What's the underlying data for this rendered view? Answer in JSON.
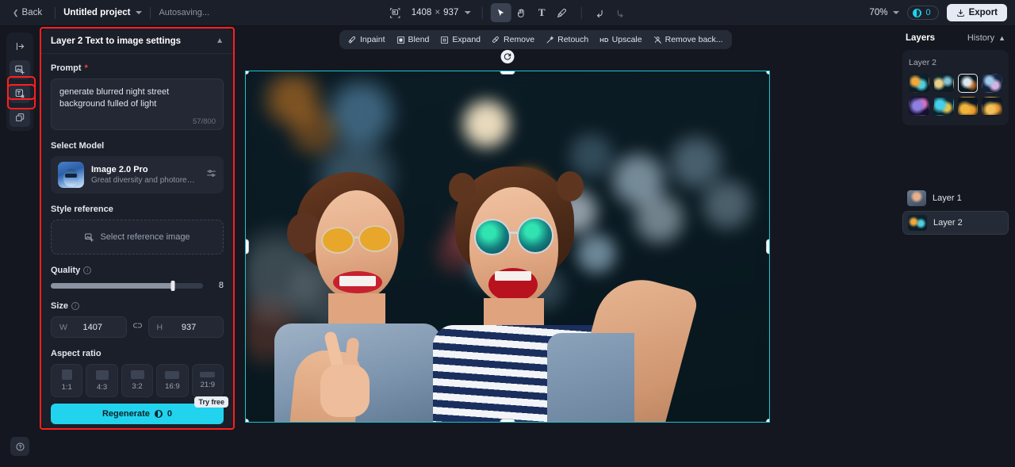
{
  "topbar": {
    "back_label": "Back",
    "project_name": "Untitled project",
    "autosave_status": "Autosaving...",
    "dimensions_w": "1408",
    "dimensions_x": "×",
    "dimensions_h": "937",
    "zoom_level": "70%",
    "credits_count": "0",
    "export_label": "Export",
    "tools": [
      {
        "name": "select-tool",
        "glyph": "cursor"
      },
      {
        "name": "hand-tool",
        "glyph": "hand"
      },
      {
        "name": "text-tool",
        "glyph": "T"
      },
      {
        "name": "brush-tool",
        "glyph": "brush"
      },
      {
        "name": "undo-tool",
        "glyph": "undo"
      },
      {
        "name": "redo-tool",
        "glyph": "redo"
      }
    ]
  },
  "panel": {
    "title": "Layer 2 Text to image settings",
    "prompt_label": "Prompt",
    "prompt_required_mark": "*",
    "prompt_value": "generate blurred night street background fulled of light",
    "prompt_char_count": "57/800",
    "model_label": "Select Model",
    "model_name": "Image 2.0 Pro",
    "model_desc": "Great diversity and photorealism. Of...",
    "style_label": "Style reference",
    "style_placeholder": "Select reference image",
    "quality_label": "Quality",
    "quality_value": "8",
    "quality_percent": 80,
    "size_label": "Size",
    "size_w_key": "W",
    "size_w_value": "1407",
    "size_h_key": "H",
    "size_h_value": "937",
    "ratio_label": "Aspect ratio",
    "ratios": [
      {
        "label": "1:1",
        "w": 13,
        "h": 13
      },
      {
        "label": "4:3",
        "w": 16,
        "h": 12
      },
      {
        "label": "3:2",
        "w": 17,
        "h": 11
      },
      {
        "label": "16:9",
        "w": 18,
        "h": 10
      },
      {
        "label": "21:9",
        "w": 19,
        "h": 7
      }
    ],
    "regenerate_label": "Regenerate",
    "regenerate_cost": "0",
    "try_free_badge": "Try free"
  },
  "canvas_toolbar": [
    {
      "label": "Inpaint",
      "icon": "inpaint-icon"
    },
    {
      "label": "Blend",
      "icon": "blend-icon"
    },
    {
      "label": "Expand",
      "icon": "expand-icon"
    },
    {
      "label": "Remove",
      "icon": "remove-icon"
    },
    {
      "label": "Retouch",
      "icon": "retouch-icon"
    },
    {
      "label": "Upscale",
      "icon": "hd-icon"
    },
    {
      "label": "Remove back...",
      "icon": "remove-background-icon"
    }
  ],
  "right_panel": {
    "layers_title": "Layers",
    "history_label": "History",
    "active_layer_name": "Layer 2",
    "variation_count": 8,
    "layers": [
      {
        "label": "Layer 1",
        "active": false
      },
      {
        "label": "Layer 2",
        "active": true
      }
    ]
  },
  "left_rail": {
    "items": [
      {
        "name": "collapse-panel-icon",
        "highlighted": false
      },
      {
        "name": "image-generate-icon",
        "highlighted": true
      },
      {
        "name": "text-to-image-icon",
        "highlighted": true
      },
      {
        "name": "layers-stack-icon",
        "highlighted": false
      }
    ],
    "help_label": "?"
  },
  "colors": {
    "accent": "#22d3ee",
    "selection": "#16c6d4",
    "highlight": "#ff1f1f",
    "panel_bg": "#1b1f29",
    "app_bg": "#14171f"
  }
}
